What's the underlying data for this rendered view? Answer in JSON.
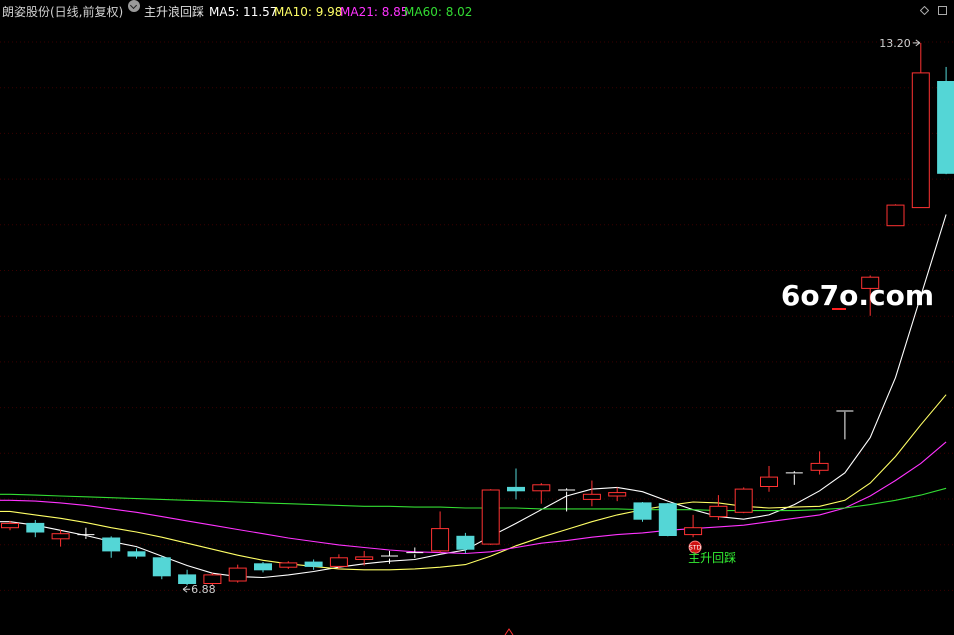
{
  "header": {
    "title": "朗姿股份(日线,前复权)",
    "indicator_name": "主升浪回踩",
    "ma5": "MA5: 11.57",
    "ma10": "MA10: 9.98",
    "ma21": "MA21: 8.85",
    "ma60": "MA60: 8.02"
  },
  "watermark": "6o7o.com",
  "colors": {
    "up": "#ff3232",
    "down": "#54d6d6",
    "ma5": "#ffffff",
    "ma10": "#ffff66",
    "ma21": "#ff33ff",
    "ma60": "#33dd33",
    "title": "#d0d0d0",
    "signal": "#33ee33"
  },
  "chart_data": {
    "type": "candlestick",
    "ylim": [
      6.3,
      13.7
    ],
    "high_label": "13.20",
    "low_label": "6.88",
    "signal_label": "主升回踩",
    "signal_badge": "STD",
    "candles": [
      {
        "o": 7.55,
        "c": 7.6,
        "h": 7.63,
        "l": 7.52
      },
      {
        "o": 7.6,
        "c": 7.5,
        "h": 7.64,
        "l": 7.44
      },
      {
        "o": 7.42,
        "c": 7.48,
        "h": 7.53,
        "l": 7.33
      },
      {
        "o": 7.47,
        "c": 7.45,
        "h": 7.55,
        "l": 7.42
      },
      {
        "o": 7.43,
        "c": 7.28,
        "h": 7.45,
        "l": 7.2
      },
      {
        "o": 7.27,
        "c": 7.22,
        "h": 7.31,
        "l": 7.19
      },
      {
        "o": 7.2,
        "c": 6.99,
        "h": 7.22,
        "l": 6.95
      },
      {
        "o": 7.0,
        "c": 6.9,
        "h": 7.06,
        "l": 6.88
      },
      {
        "o": 6.9,
        "c": 7.0,
        "h": 7.02,
        "l": 6.88
      },
      {
        "o": 6.93,
        "c": 7.08,
        "h": 7.12,
        "l": 6.91
      },
      {
        "o": 7.13,
        "c": 7.06,
        "h": 7.15,
        "l": 7.03
      },
      {
        "o": 7.09,
        "c": 7.14,
        "h": 7.16,
        "l": 7.07
      },
      {
        "o": 7.15,
        "c": 7.1,
        "h": 7.18,
        "l": 7.06
      },
      {
        "o": 7.1,
        "c": 7.2,
        "h": 7.24,
        "l": 7.07
      },
      {
        "o": 7.18,
        "c": 7.21,
        "h": 7.28,
        "l": 7.11
      },
      {
        "o": 7.19,
        "c": 7.22,
        "h": 7.28,
        "l": 7.13
      },
      {
        "o": 7.24,
        "c": 7.26,
        "h": 7.32,
        "l": 7.2
      },
      {
        "o": 7.28,
        "c": 7.54,
        "h": 7.74,
        "l": 7.26
      },
      {
        "o": 7.45,
        "c": 7.3,
        "h": 7.49,
        "l": 7.25
      },
      {
        "o": 7.36,
        "c": 7.99,
        "h": 8.0,
        "l": 7.35
      },
      {
        "o": 8.02,
        "c": 7.98,
        "h": 8.24,
        "l": 7.88
      },
      {
        "o": 7.98,
        "c": 8.05,
        "h": 8.07,
        "l": 7.83
      },
      {
        "o": 7.99,
        "c": 7.97,
        "h": 8.01,
        "l": 7.74
      },
      {
        "o": 7.88,
        "c": 7.94,
        "h": 8.1,
        "l": 7.8
      },
      {
        "o": 7.92,
        "c": 7.96,
        "h": 8.02,
        "l": 7.86
      },
      {
        "o": 7.84,
        "c": 7.65,
        "h": 7.85,
        "l": 7.62
      },
      {
        "o": 7.83,
        "c": 7.46,
        "h": 7.84,
        "l": 7.45
      },
      {
        "o": 7.47,
        "c": 7.55,
        "h": 7.7,
        "l": 7.44
      },
      {
        "o": 7.68,
        "c": 7.8,
        "h": 7.93,
        "l": 7.64
      },
      {
        "o": 7.73,
        "c": 8.0,
        "h": 8.02,
        "l": 7.72
      },
      {
        "o": 8.03,
        "c": 8.14,
        "h": 8.27,
        "l": 7.97
      },
      {
        "o": 8.19,
        "c": 8.17,
        "h": 8.21,
        "l": 8.05
      },
      {
        "o": 8.22,
        "c": 8.3,
        "h": 8.44,
        "l": 8.17
      },
      {
        "o": 8.91,
        "c": 8.9,
        "h": 8.91,
        "l": 8.58
      },
      {
        "o": 10.34,
        "c": 10.47,
        "h": 10.49,
        "l": 10.02
      },
      {
        "o": 11.07,
        "c": 11.31,
        "h": 11.32,
        "l": 11.07
      },
      {
        "o": 11.28,
        "c": 12.85,
        "h": 13.2,
        "l": 11.28
      },
      {
        "o": 12.75,
        "c": 11.68,
        "h": 12.92,
        "l": 11.67
      }
    ],
    "series": [
      {
        "name": "MA5",
        "values": [
          7.62,
          7.58,
          7.52,
          7.46,
          7.39,
          7.33,
          7.22,
          7.11,
          7.02,
          6.98,
          6.97,
          7.0,
          7.04,
          7.09,
          7.13,
          7.16,
          7.18,
          7.24,
          7.29,
          7.45,
          7.6,
          7.76,
          7.92,
          8.0,
          8.02,
          7.97,
          7.86,
          7.76,
          7.68,
          7.65,
          7.7,
          7.82,
          7.98,
          8.19,
          8.6,
          9.3,
          10.25,
          11.2
        ]
      },
      {
        "name": "MA10",
        "values": [
          7.74,
          7.7,
          7.66,
          7.61,
          7.55,
          7.5,
          7.44,
          7.37,
          7.3,
          7.23,
          7.17,
          7.13,
          7.1,
          7.07,
          7.06,
          7.06,
          7.07,
          7.09,
          7.12,
          7.22,
          7.34,
          7.44,
          7.53,
          7.62,
          7.7,
          7.76,
          7.81,
          7.85,
          7.84,
          7.8,
          7.78,
          7.79,
          7.8,
          7.87,
          8.07,
          8.38,
          8.75,
          9.1
        ]
      },
      {
        "name": "MA21",
        "values": [
          7.87,
          7.86,
          7.84,
          7.81,
          7.77,
          7.73,
          7.68,
          7.63,
          7.58,
          7.53,
          7.48,
          7.43,
          7.39,
          7.35,
          7.32,
          7.29,
          7.27,
          7.26,
          7.25,
          7.27,
          7.32,
          7.37,
          7.4,
          7.44,
          7.47,
          7.49,
          7.52,
          7.54,
          7.56,
          7.58,
          7.62,
          7.66,
          7.7,
          7.78,
          7.92,
          8.1,
          8.3,
          8.55
        ]
      },
      {
        "name": "MA60",
        "values": [
          7.94,
          7.93,
          7.92,
          7.91,
          7.9,
          7.89,
          7.88,
          7.87,
          7.86,
          7.85,
          7.84,
          7.83,
          7.82,
          7.81,
          7.8,
          7.8,
          7.79,
          7.79,
          7.78,
          7.78,
          7.78,
          7.77,
          7.77,
          7.77,
          7.77,
          7.76,
          7.76,
          7.76,
          7.75,
          7.75,
          7.75,
          7.75,
          7.76,
          7.78,
          7.82,
          7.87,
          7.93,
          8.01
        ]
      }
    ]
  }
}
